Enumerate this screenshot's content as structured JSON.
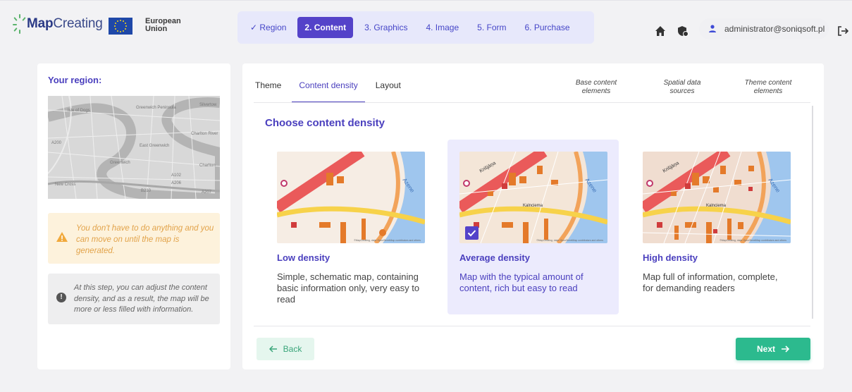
{
  "header": {
    "logo_bold": "Map",
    "logo_rest": "Creating",
    "eu_label_line1": "European",
    "eu_label_line2": "Union",
    "steps": [
      {
        "label": "✓ Region",
        "state": "done"
      },
      {
        "label": "2. Content",
        "state": "active"
      },
      {
        "label": "3. Graphics",
        "state": "todo"
      },
      {
        "label": "4. Image",
        "state": "todo"
      },
      {
        "label": "5. Form",
        "state": "todo"
      },
      {
        "label": "6. Purchase",
        "state": "todo"
      }
    ],
    "icons": [
      "home-icon",
      "shield-badge-icon",
      "user-icon",
      "logout-icon"
    ],
    "user_email": "administrator@soniqsoft.pl"
  },
  "left": {
    "region_title": "Your region:",
    "map_labels": [
      "Isle of Dogs",
      "Greenwich Peninsula",
      "Silvertow",
      "Charlton River",
      "East Greenwich",
      "Greenwich",
      "Charlton",
      "New Cross",
      "A200",
      "A102",
      "A206",
      "B210",
      "A207"
    ],
    "warning_text": "You don't have to do anything and you can move on until the map is generated.",
    "info_text": "At this step, you can adjust the content density, and as a result, the map will be more or less filled with information."
  },
  "main": {
    "tabs": [
      "Theme",
      "Content density",
      "Layout"
    ],
    "active_tab": "Content density",
    "right_tabs": [
      {
        "line1": "Base content",
        "line2": "elements"
      },
      {
        "line1": "Spatial data",
        "line2": "sources"
      },
      {
        "line1": "Theme content",
        "line2": "elements"
      }
    ],
    "section_title": "Choose content density",
    "cards": [
      {
        "title": "Low density",
        "description": "Simple, schematic map, containing basic information only, very easy to read",
        "selected": false
      },
      {
        "title": "Average density",
        "description": "Map with the typical amount of content, rich but easy to read",
        "selected": true
      },
      {
        "title": "High density",
        "description": "Map full of information, complete, for demanding readers",
        "selected": false
      }
    ],
    "map_street_label": "Azene",
    "map_credit": "©MapCreating, data: OpenStreetMap contributors and others",
    "back_label": "Back",
    "next_label": "Next"
  },
  "colors": {
    "accent": "#5442c9",
    "accent_text": "#4a3fbe",
    "success": "#2cba8e",
    "warning_bg": "#fdf2dc",
    "warning_text": "#e2a34a"
  }
}
